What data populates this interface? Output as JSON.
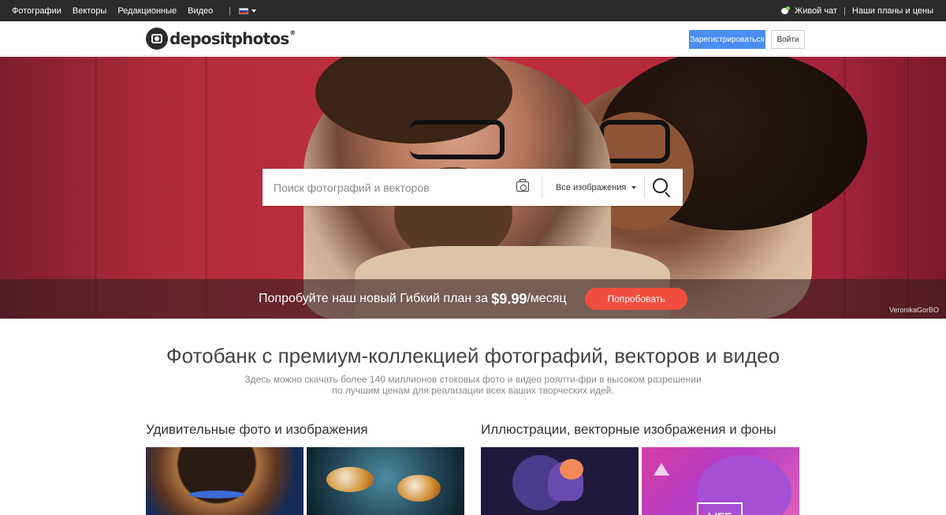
{
  "topbar": {
    "nav": [
      "Фотографии",
      "Векторы",
      "Редакционные",
      "Видео"
    ],
    "separator": "|",
    "live_chat": "Живой чат",
    "pipe": "|",
    "plans": "Наши планы и цены"
  },
  "header": {
    "logo_text": "depositphotos",
    "logo_reg": "®",
    "register_label": "Зарегистрироваться",
    "login_label": "Войти"
  },
  "hero": {
    "search_placeholder": "Поиск фотографий и векторов",
    "filter_label": "Все изображения",
    "promo_prefix": "Попробуйте наш новый Гибкий план за ",
    "promo_price": "$9.99",
    "promo_suffix": "/месяц",
    "promo_button": "Попробовать",
    "credit": "VeronikaGorBO"
  },
  "intro": {
    "title": "Фотобанк с премиум-коллекцией фотографий, векторов и видео",
    "subtitle_line1": "Здесь можно скачать более 140 миллионов стоковых фото и видео роялти-фри в высоком разрешении",
    "subtitle_line2": "по лучшим ценам для реализации всех ваших творческих идей."
  },
  "sections": {
    "photos_title": "Удивительные фото и изображения",
    "illustrations_title": "Иллюстрации, векторные изображения и фоны",
    "thumb_text": "LIFE"
  },
  "colors": {
    "register_button": "#4a8ef0",
    "promo_button": "#f04e3e",
    "topbar": "#2b2b2b"
  }
}
